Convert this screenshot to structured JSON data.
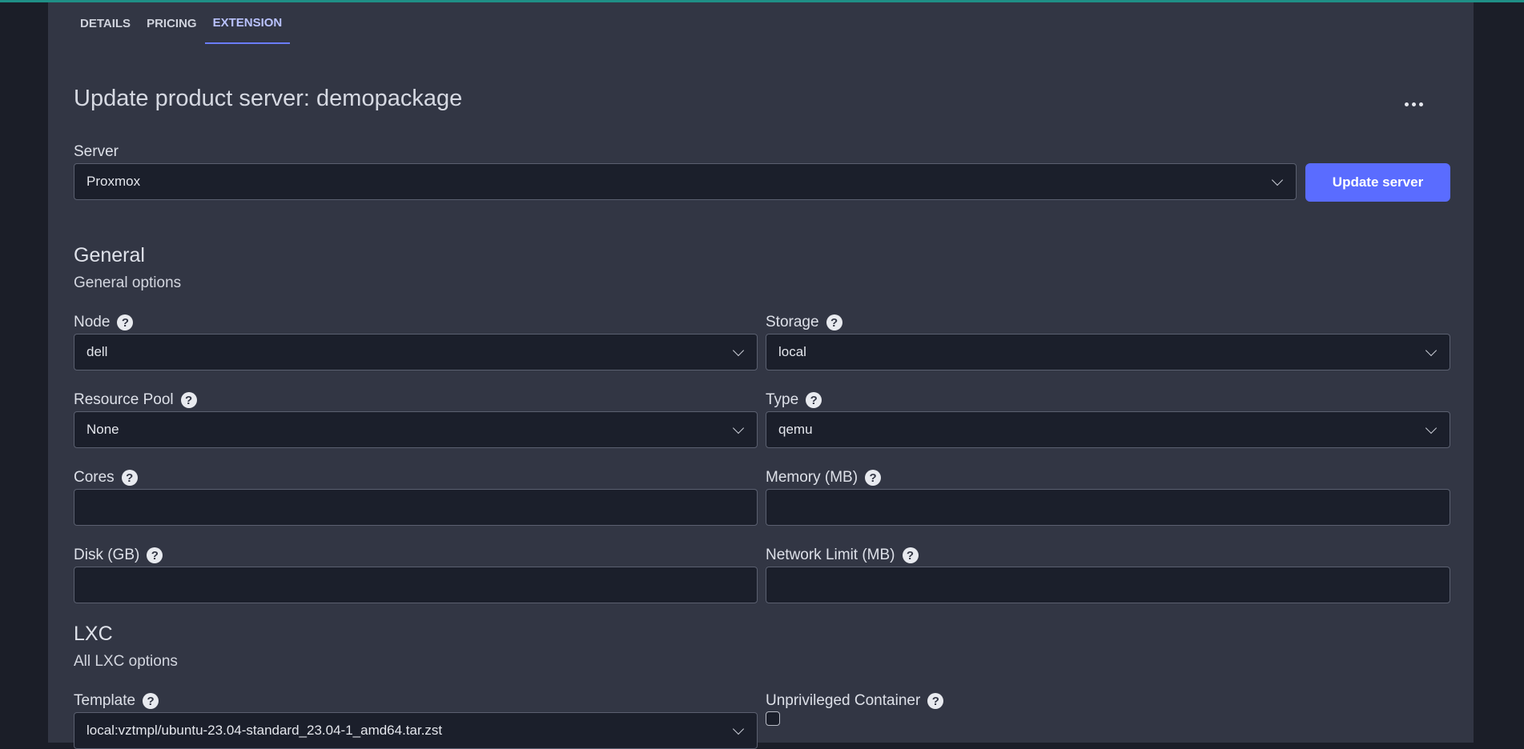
{
  "tabs": [
    {
      "label": "DETAILS",
      "active": false
    },
    {
      "label": "PRICING",
      "active": false
    },
    {
      "label": "EXTENSION",
      "active": true
    }
  ],
  "page": {
    "title": "Update product server: demopackage"
  },
  "server": {
    "label": "Server",
    "value": "Proxmox",
    "button_label": "Update server"
  },
  "general": {
    "title": "General",
    "subtitle": "General options",
    "fields": {
      "node": {
        "label": "Node",
        "value": "dell"
      },
      "storage": {
        "label": "Storage",
        "value": "local"
      },
      "resource_pool": {
        "label": "Resource Pool",
        "value": "None"
      },
      "type": {
        "label": "Type",
        "value": "qemu"
      },
      "cores": {
        "label": "Cores",
        "value": ""
      },
      "memory": {
        "label": "Memory (MB)",
        "value": ""
      },
      "disk": {
        "label": "Disk (GB)",
        "value": ""
      },
      "network_limit": {
        "label": "Network Limit (MB)",
        "value": ""
      }
    }
  },
  "lxc": {
    "title": "LXC",
    "subtitle": "All LXC options",
    "fields": {
      "template": {
        "label": "Template",
        "value": "local:vztmpl/ubuntu-23.04-standard_23.04-1_amd64.tar.zst"
      },
      "unprivileged": {
        "label": "Unprivileged Container",
        "checked": false
      }
    }
  },
  "help_glyph": "?",
  "colors": {
    "accent": "#5a6cff",
    "panel": "#323644",
    "background": "#1b1e28",
    "input_bg": "#1b1f2b",
    "top_line": "#1f8f86"
  },
  "icons": {
    "help": "question-circle-icon",
    "dropdown": "chevron-down-icon",
    "more": "more-horizontal-icon"
  }
}
